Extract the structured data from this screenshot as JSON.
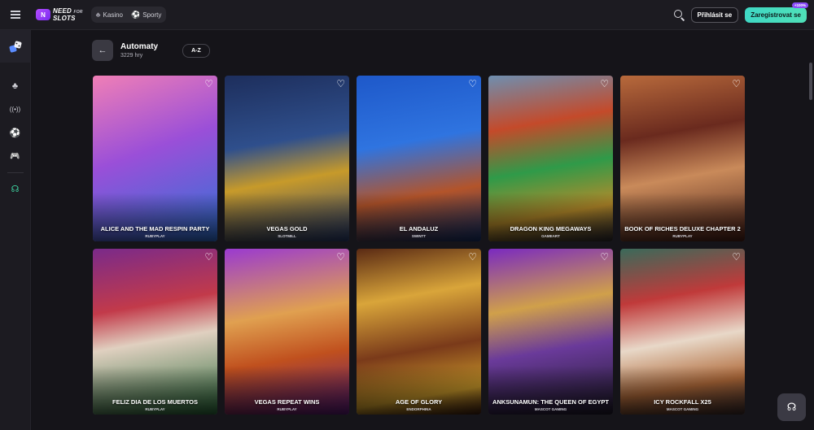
{
  "brand": {
    "logo_mark": "N",
    "logo_line1": "NEED",
    "logo_line1_small": "FOR",
    "logo_line2": "SLOTS"
  },
  "nav": {
    "casino": "Kasino",
    "sports": "Sporty"
  },
  "auth": {
    "login": "Přihlásit se",
    "register": "Zaregistrovat se",
    "register_badge": "+100%"
  },
  "sidebar": {
    "items": [
      {
        "icon": "slots-icon"
      },
      {
        "icon": "cherries-icon",
        "glyph": "♣"
      },
      {
        "icon": "live-broadcast-icon",
        "glyph": "((•))"
      },
      {
        "icon": "football-icon",
        "glyph": "⚽"
      },
      {
        "icon": "gamepad-icon",
        "glyph": "🎮"
      },
      {
        "icon": "support-icon",
        "glyph": "☊"
      }
    ]
  },
  "header": {
    "back": "←",
    "title": "Automaty",
    "count": "3229 hry",
    "sort": "A-Z"
  },
  "games": [
    {
      "name": "Alice and the Mad Respin Party",
      "provider": "RUBYPLAY",
      "bg": "linear-gradient(160deg,#f07fb6 0%,#9a4fd8 45%,#2f72d6 100%)"
    },
    {
      "name": "Vegas Gold",
      "provider": "SLOTMILL",
      "bg": "linear-gradient(170deg,#1d2e5c 0%,#2f4f8c 40%,#c79a2a 62%,#2a3f73 100%)"
    },
    {
      "name": "El Andaluz",
      "provider": "SWINTT",
      "bg": "linear-gradient(170deg,#1e58c9 0%,#2f74e0 40%,#b3542a 70%,#15326e 100%)"
    },
    {
      "name": "Dragon King Megaways",
      "provider": "GAMEART",
      "bg": "linear-gradient(170deg,#6e8fb0 0%,#c44a2a 30%,#2f9a49 55%,#b58a2a 80%,#2c2a30 100%)"
    },
    {
      "name": "Book of Riches Deluxe Chapter 2",
      "provider": "RUBYPLAY",
      "bg": "linear-gradient(170deg,#b86a3c 0%,#6a2a1e 35%,#c98a5a 60%,#4a1e16 100%)"
    },
    {
      "name": "Feliz Dia de los Muertos",
      "provider": "RUBYPLAY",
      "bg": "linear-gradient(170deg,#7a2a8a 0%,#c23a4a 35%,#e0d0c0 55%,#2a6a3a 100%)"
    },
    {
      "name": "Vegas Repeat Wins",
      "provider": "RUBYPLAY",
      "bg": "linear-gradient(170deg,#9a3ad0 0%,#e0a050 40%,#c0501e 65%,#5a1a7a 100%)"
    },
    {
      "name": "Age of Glory",
      "provider": "ENDORPHINA",
      "bg": "linear-gradient(170deg,#5a2a14 0%,#d9a53a 30%,#7a3a1a 60%,#c8982a 85%,#3a1a0e 100%)"
    },
    {
      "name": "Anksunamun: The Queen of Egypt",
      "provider": "MASCOT GAMING",
      "bg": "linear-gradient(170deg,#7a2ac0 0%,#d0a04a 35%,#6a3a9a 60%,#1e1a2a 100%)"
    },
    {
      "name": "Icy Rockfall X25",
      "provider": "MASCOT GAMING",
      "bg": "linear-gradient(170deg,#3a6a5a 0%,#c03a3a 30%,#e8d8c8 55%,#b06a3a 80%,#3a2a2a 100%)"
    }
  ],
  "support": {
    "glyph": "☊"
  }
}
